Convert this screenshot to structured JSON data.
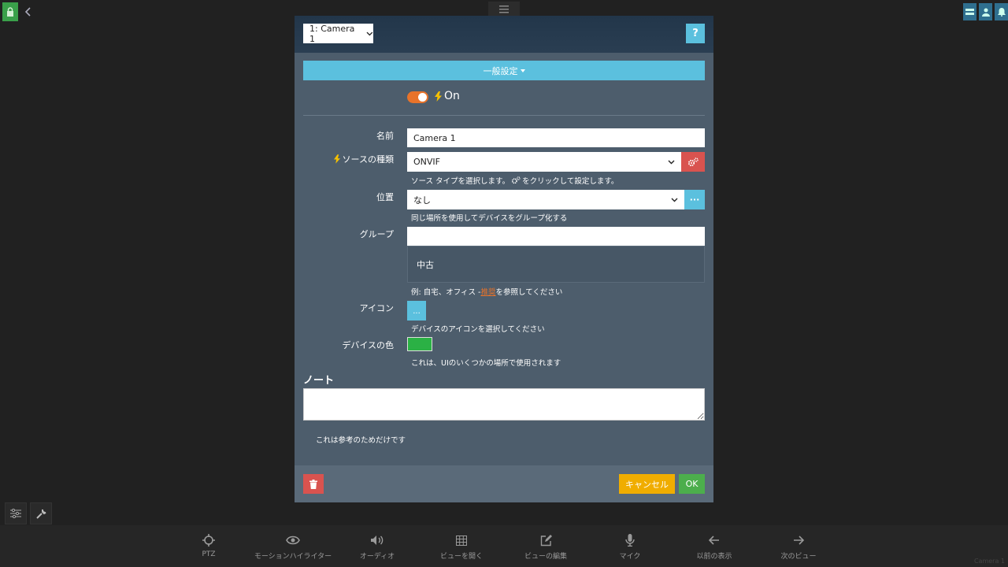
{
  "topbar": {
    "lock_icon": "lock-icon",
    "back_icon": "chevron-left-icon",
    "menu_icon": "hamburger-icon",
    "right_icons": [
      "layout-icon",
      "user-icon",
      "bell-icon"
    ]
  },
  "modal": {
    "camera_select": "1: Camera 1",
    "help_label": "?",
    "section_label": "一般設定",
    "toggle_on": true,
    "toggle_label": "On",
    "fields": {
      "name_label": "名前",
      "name_value": "Camera 1",
      "source_label": "ソースの種類",
      "source_value": "ONVIF",
      "source_hint_a": "ソース タイプを選択します。",
      "source_hint_b": "をクリックして設定します。",
      "location_label": "位置",
      "location_value": "なし",
      "location_button": "···",
      "location_hint": "同じ場所を使用してデバイスをグループ化する",
      "group_label": "グループ",
      "group_value": "",
      "group_option": "中古",
      "group_hint_a": "例: 自宅、オフィス -",
      "group_hint_link": "推奨",
      "group_hint_b": "を参照してください",
      "icon_label": "アイコン",
      "icon_button": "...",
      "icon_hint": "デバイスのアイコンを選択してください",
      "color_label": "デバイスの色",
      "color_value": "#2bb145",
      "color_hint": "これは、UIのいくつかの場所で使用されます"
    },
    "note_title": "ノート",
    "note_value": "",
    "note_hint": "これは参考のためだけです",
    "cancel_label": "キャンセル",
    "ok_label": "OK"
  },
  "bottom_bar": [
    {
      "label": "PTZ",
      "icon": "crosshair-icon"
    },
    {
      "label": "モーションハイライター",
      "icon": "eye-icon"
    },
    {
      "label": "オーディオ",
      "icon": "speaker-icon"
    },
    {
      "label": "ビューを開く",
      "icon": "grid-icon"
    },
    {
      "label": "ビューの編集",
      "icon": "edit-icon"
    },
    {
      "label": "マイク",
      "icon": "microphone-icon"
    },
    {
      "label": "以前の表示",
      "icon": "arrow-left-icon"
    },
    {
      "label": "次のビュー",
      "icon": "arrow-right-icon"
    }
  ],
  "watermark": "Camera 1"
}
